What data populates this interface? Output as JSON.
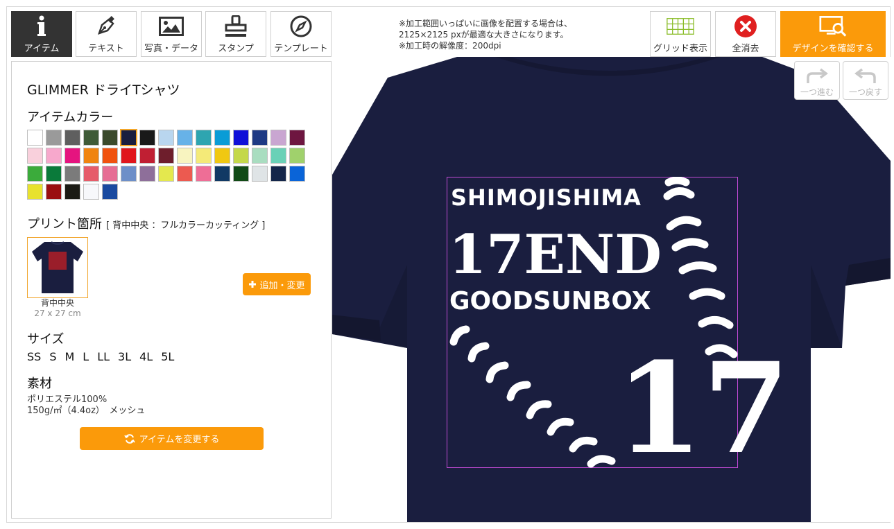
{
  "toolbar": {
    "item": "アイテム",
    "text": "テキスト",
    "photo": "写真・データ",
    "stamp": "スタンプ",
    "template": "テンプレート",
    "grid": "グリッド表示",
    "clear_all": "全消去",
    "confirm": "デザインを確認する"
  },
  "notice": {
    "line1": "※加工範囲いっぱいに画像を配置する場合は、",
    "line2": "2125×2125 pxが最適な大きさになります。",
    "line3": "※加工時の解像度：200dpi"
  },
  "history": {
    "redo": "一つ進む",
    "undo": "一つ戻す"
  },
  "panel": {
    "product_title": "GLIMMER ドライTシャツ",
    "color_heading": "アイテムカラー",
    "colors": [
      "#ffffff",
      "#9a9a9a",
      "#5f5f5f",
      "#3e5a37",
      "#3b4a2c",
      "#1a1e3f",
      "#191919",
      "#b9d6ef",
      "#67b2e8",
      "#2ea5b0",
      "#0a9cd6",
      "#1010d8",
      "#1e3a84",
      "#c9a6d1",
      "#6e1640",
      "#f9d0dc",
      "#f7a8cc",
      "#e5147f",
      "#f0840f",
      "#f0520f",
      "#e0161c",
      "#c01f33",
      "#6e1e2c",
      "#f8f4c0",
      "#f4ea78",
      "#f0c812",
      "#c4d84a",
      "#a9ddc0",
      "#6ad1b7",
      "#a0d16c",
      "#3bab3b",
      "#0a7a3a",
      "#7b7b7b",
      "#e65c6a",
      "#e66e94",
      "#6d8fc8",
      "#8e6f9a",
      "#e4e84e",
      "#ec5a50",
      "#ee6e96",
      "#113964",
      "#114a16",
      "#dfe4e6",
      "#14264a",
      "#0a64d8",
      "#e8e22e",
      "#9a0e10",
      "#1a1a14",
      "#f7f8fb",
      "#1a4aa0"
    ],
    "selected_color_index": 5,
    "print_heading": "プリント箇所",
    "print_note": "[ 背中中央 ：フルカラーカッティング ]",
    "print_location": "背中中央",
    "print_size": "27 x 27 cm",
    "add_change": "追加・変更",
    "size_heading": "サイズ",
    "sizes": [
      "SS",
      "S",
      "M",
      "L",
      "LL",
      "3L",
      "4L",
      "5L"
    ],
    "material_heading": "素材",
    "material_line1": "ポリエステル100%",
    "material_line2": "150g/㎡（4.4oz）　メッシュ",
    "change_item": "アイテムを変更する"
  },
  "design": {
    "line1": "SHIMOJISHIMA",
    "line2": "17END",
    "line3": "GOODSUNBOX",
    "number": "17",
    "shirt_color": "#1a1e3f",
    "print_color": "#ffffff",
    "area_border_color": "#c24bd6"
  }
}
